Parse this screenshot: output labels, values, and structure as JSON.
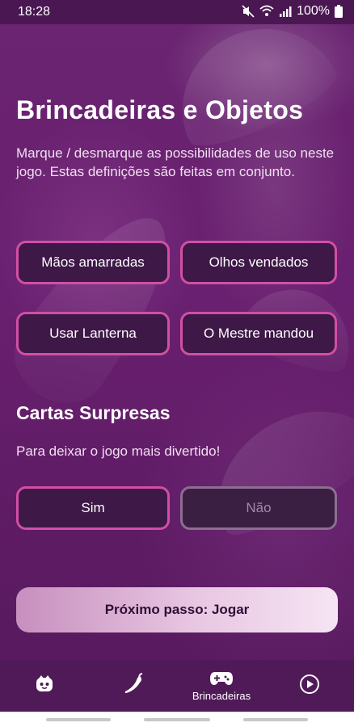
{
  "status_bar": {
    "time": "18:28",
    "battery_text": "100%",
    "icons": [
      "mute-icon",
      "wifi-icon",
      "signal-icon",
      "battery-icon"
    ]
  },
  "page": {
    "title": "Brincadeiras e Objetos",
    "description": "Marque / desmarque as possibilidades de uso neste jogo. Estas definições são feitas em conjunto."
  },
  "options": [
    {
      "label": "Mãos amarradas",
      "selected": true
    },
    {
      "label": "Olhos vendados",
      "selected": true
    },
    {
      "label": "Usar Lanterna",
      "selected": true
    },
    {
      "label": "O Mestre mandou",
      "selected": true
    }
  ],
  "surprise_cards": {
    "title": "Cartas Surpresas",
    "subtitle": "Para deixar o jogo mais divertido!",
    "yes_label": "Sim",
    "no_label": "Não",
    "selected": "Sim"
  },
  "next_button": {
    "label": "Próximo passo: Jogar"
  },
  "bottom_nav": {
    "items": [
      {
        "icon": "face-icon",
        "label": ""
      },
      {
        "icon": "pepper-icon",
        "label": ""
      },
      {
        "icon": "gamepad-icon",
        "label": "Brincadeiras",
        "active": true
      },
      {
        "icon": "play-circle-icon",
        "label": ""
      }
    ]
  },
  "colors": {
    "accent_border": "#d24fa4",
    "background": "#6a2070",
    "button_fill": "#3e1847"
  }
}
